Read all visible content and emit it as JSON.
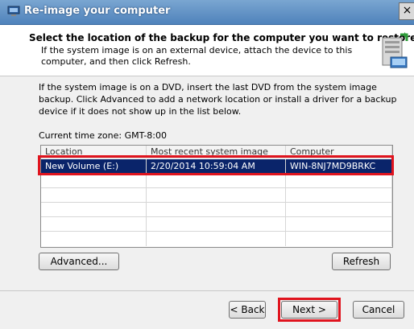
{
  "window": {
    "title": "Re-image your computer",
    "close_glyph": "×"
  },
  "header": {
    "title": "Select the location of the backup for the computer you want to restore",
    "description": "If the system image is on an external device, attach the device to this computer, and then click Refresh.",
    "icon": "computer-restore-icon"
  },
  "body": {
    "instructions": "If the system image is on a DVD, insert the last DVD from the system image backup. Click Advanced to add a network location or install a driver for a backup device if it does not show up in the list below.",
    "timezone_label": "Current time zone: GMT-8:00"
  },
  "table": {
    "columns": [
      "Location",
      "Most recent system image",
      "Computer"
    ],
    "rows": [
      {
        "location": "New Volume (E:)",
        "date": "2/20/2014 10:59:04 AM",
        "computer": "WIN-8NJ7MD9BRKC",
        "selected": true
      }
    ]
  },
  "buttons": {
    "advanced": "Advanced...",
    "refresh": "Refresh",
    "back": "< Back",
    "next": "Next >",
    "cancel": "Cancel"
  },
  "colors": {
    "selection": "#0a246a",
    "highlight": "#e0141e",
    "titlebar": "#5b8ec5"
  }
}
